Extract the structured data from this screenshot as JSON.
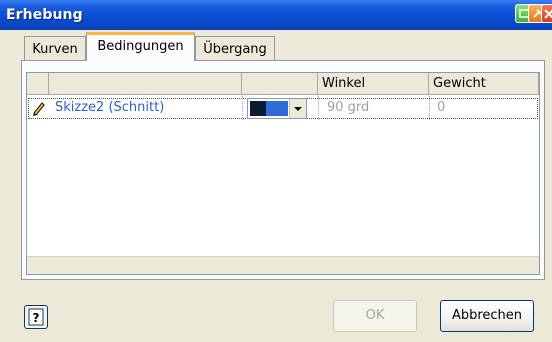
{
  "window": {
    "title": "Erhebung"
  },
  "tabs": [
    {
      "label": "Kurven",
      "selected": false
    },
    {
      "label": "Bedingungen",
      "selected": true
    },
    {
      "label": "Übergang",
      "selected": false
    }
  ],
  "grid": {
    "columns": [
      "",
      "",
      "",
      "Winkel",
      "Gewicht"
    ],
    "rows": [
      {
        "icon": "pencil-icon",
        "name": "Skizze2 (Schnitt)",
        "condition": "colored-swatch",
        "angle": "90 grd",
        "weight": "0"
      }
    ]
  },
  "buttons": {
    "ok": "OK",
    "cancel": "Abbrechen",
    "help_icon": "help-icon"
  },
  "colors": {
    "titlebar": "#0a4cd4",
    "selected_tab_accent": "#f9b649",
    "link_blue": "#2e5fc4"
  }
}
